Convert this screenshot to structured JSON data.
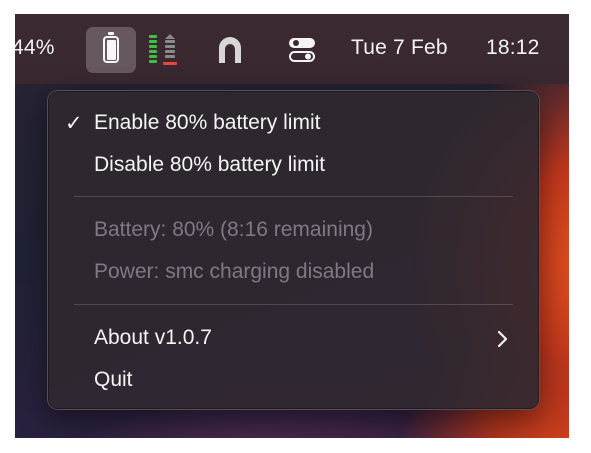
{
  "menubar": {
    "battery_percent": "44%",
    "date": "Tue 7 Feb",
    "time": "18:12",
    "icons": [
      "battery-icon",
      "meter-icon",
      "shield-arch-icon",
      "control-center-icon"
    ]
  },
  "menu": {
    "items": [
      {
        "label": "Enable 80% battery limit",
        "checked": true,
        "check_glyph": "✓"
      },
      {
        "label": "Disable 80% battery limit",
        "checked": false
      }
    ],
    "info": [
      {
        "label": "Battery: 80% (8:16 remaining)"
      },
      {
        "label": "Power: smc charging disabled"
      }
    ],
    "about_label": "About v1.0.7",
    "quit_label": "Quit"
  },
  "colors": {
    "menubar_bg": "#3c2a32",
    "menu_bg": "#302830",
    "text": "#f5f5f5",
    "disabled_text": "#807883",
    "meter_green": "#3fbf4a",
    "meter_red": "#e8453c"
  }
}
